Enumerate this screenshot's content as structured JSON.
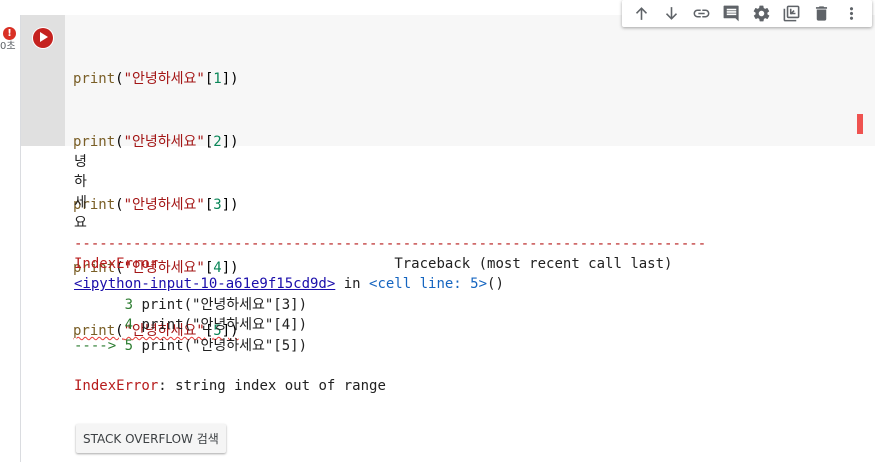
{
  "cell": {
    "status_badge": "!",
    "exec_count": "0초",
    "code_lines": [
      {
        "fn": "print",
        "open": "(",
        "str": "\"안녕하세요\"",
        "lb": "[",
        "num": "1",
        "rb": "])"
      },
      {
        "fn": "print",
        "open": "(",
        "str": "\"안녕하세요\"",
        "lb": "[",
        "num": "2",
        "rb": "])"
      },
      {
        "fn": "print",
        "open": "(",
        "str": "\"안녕하세요\"",
        "lb": "[",
        "num": "3",
        "rb": "])"
      },
      {
        "fn": "print",
        "open": "(",
        "str": "\"안녕하세요\"",
        "lb": "[",
        "num": "4",
        "rb": "])"
      },
      {
        "fn": "print",
        "open": "(",
        "str": "\"안녕하세요\"",
        "lb": "[",
        "num": "5",
        "rb": "])"
      }
    ]
  },
  "toolbar": {
    "icons": [
      "arrow-up-icon",
      "arrow-down-icon",
      "link-icon",
      "comment-icon",
      "gear-icon",
      "mirror-cell-icon",
      "trash-icon",
      "more-vert-icon"
    ]
  },
  "output": {
    "stdout": [
      "녕",
      "하",
      "세",
      "요"
    ],
    "separator": "---------------------------------------------------------------------------",
    "error_name": "IndexError",
    "traceback_header": "Traceback (most recent call last)",
    "location_link": "<ipython-input-10-a61e9f15cd9d>",
    "location_in": " in ",
    "location_cell": "<cell line: 5>",
    "location_paren": "()",
    "frames": [
      {
        "arrow": "      ",
        "lineno": "3",
        "code_fn": " print(",
        "code_str": "\"안녕하세요\"",
        "code_rest": "[3])"
      },
      {
        "arrow": "      ",
        "lineno": "4",
        "code_fn": " print(",
        "code_str": "\"안녕하세요\"",
        "code_rest": "[4])"
      },
      {
        "arrow": "----> ",
        "lineno": "5",
        "code_fn": " print(",
        "code_str": "\"안녕하세요\"",
        "code_rest": "[5])"
      }
    ],
    "final_error_name": "IndexError",
    "final_error_msg": ": string index out of range"
  },
  "stack_overflow_button": "STACK OVERFLOW 검색",
  "colors": {
    "run_button": "#c5221f",
    "error_badge": "#d93025",
    "editor_bg": "#f7f7f7",
    "gutter_bg": "#e0e0e0"
  }
}
